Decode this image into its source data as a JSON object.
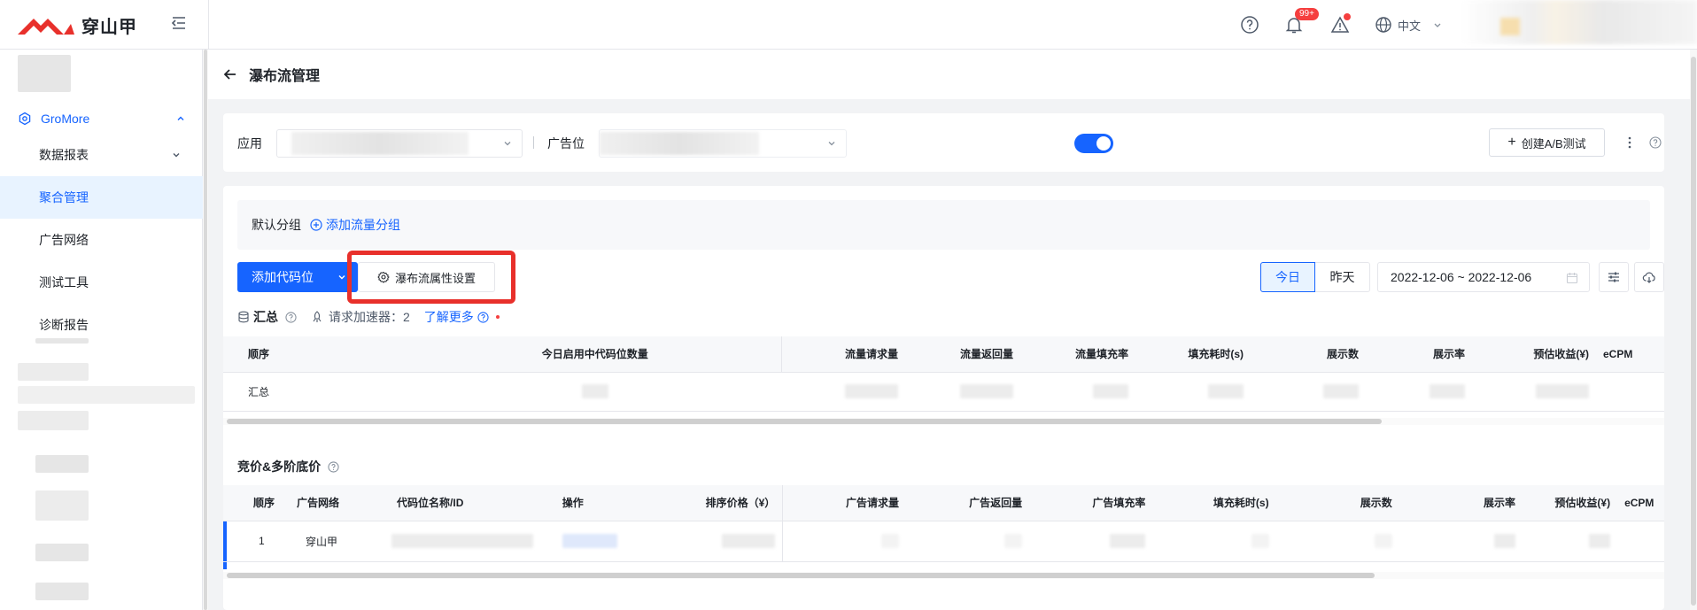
{
  "app": {
    "brand": "穿山甲",
    "brand_color": "#e8302b",
    "accent": "#1664ff"
  },
  "topbar": {
    "notification_badge": "99+",
    "language": "中文"
  },
  "sidebar": {
    "group_label": "GroMore",
    "items": [
      {
        "label": "数据报表",
        "expandable": true
      },
      {
        "label": "聚合管理",
        "active": true
      },
      {
        "label": "广告网络"
      },
      {
        "label": "测试工具"
      },
      {
        "label": "诊断报告"
      }
    ]
  },
  "page": {
    "title": "瀑布流管理"
  },
  "filters": {
    "app_label": "应用",
    "adslot_label": "广告位",
    "toggle_on": true,
    "create_ab_button": "创建A/B测试"
  },
  "group": {
    "name": "默认分组",
    "add_label": "添加流量分组"
  },
  "toolbar": {
    "add_code_button": "添加代码位",
    "waterfall_settings_button": "瀑布流属性设置",
    "today": "今日",
    "yesterday": "昨天",
    "date_range": "2022-12-06 ~ 2022-12-06"
  },
  "summary": {
    "title": "汇总",
    "accelerator_label": "请求加速器：",
    "accelerator_value": "2",
    "learn_more": "了解更多"
  },
  "summary_table": {
    "headers": [
      "顺序",
      "今日启用中代码位数量",
      "流量请求量",
      "流量返回量",
      "流量填充率",
      "填充耗时(s)",
      "展示数",
      "展示率",
      "预估收益(¥)",
      "eCPM"
    ],
    "rows": [
      {
        "order": "汇总"
      }
    ]
  },
  "bid_section": {
    "title": "竞价&多阶底价"
  },
  "bid_table": {
    "headers": [
      "顺序",
      "广告网络",
      "代码位名称/ID",
      "操作",
      "排序价格（¥）",
      "广告请求量",
      "广告返回量",
      "广告填充率",
      "填充耗时(s)",
      "展示数",
      "展示率",
      "预估收益(¥)",
      "eCPM"
    ],
    "rows": [
      {
        "order": "1",
        "network": "穿山甲"
      }
    ]
  }
}
